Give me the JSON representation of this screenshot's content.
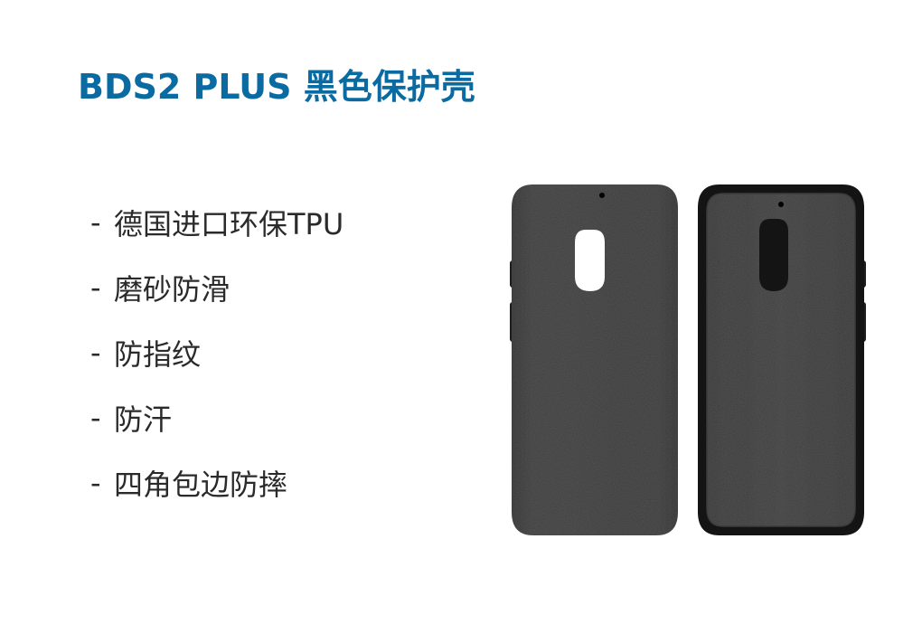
{
  "title": "BDS2 PLUS 黑色保护壳",
  "bullet": "-",
  "features": [
    "德国进口环保TPU",
    "磨砂防滑",
    "防指纹",
    "防汗",
    "四角包边防摔"
  ],
  "images": [
    {
      "icon": "phone-case-back-view"
    },
    {
      "icon": "phone-case-inside-view"
    }
  ],
  "colors": {
    "title": "#0a6aa2",
    "text": "#2a2a2a",
    "case": "#262626"
  }
}
